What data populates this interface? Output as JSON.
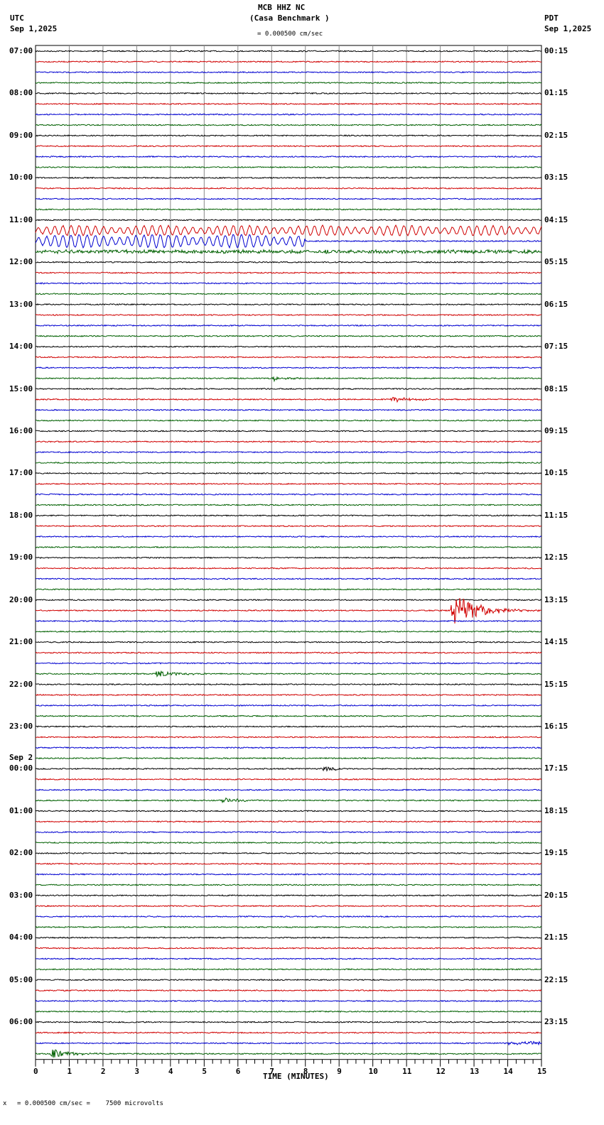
{
  "header": {
    "station": "MCB HHZ NC",
    "site": "(Casa Benchmark )",
    "left_tz": "UTC",
    "left_date": "Sep 1,2025",
    "right_tz": "PDT",
    "right_date": "Sep 1,2025",
    "scale": "= 0.000500 cm/sec"
  },
  "footer": {
    "scale": "= 0.000500 cm/sec =    7500 microvolts",
    "marker": "x"
  },
  "chart_data": {
    "type": "line",
    "title": "MCB HHZ NC (Casa Benchmark )",
    "xlabel": "TIME (MINUTES)",
    "xlim": [
      0,
      15
    ],
    "x_ticks": [
      "0",
      "1",
      "2",
      "3",
      "4",
      "5",
      "6",
      "7",
      "8",
      "9",
      "10",
      "11",
      "12",
      "13",
      "14",
      "15"
    ],
    "trace_count": 96,
    "trace_colors": [
      "#000000",
      "#d00000",
      "#0000d0",
      "#006000"
    ],
    "utc_labels": [
      "07:00",
      "08:00",
      "09:00",
      "10:00",
      "11:00",
      "12:00",
      "13:00",
      "14:00",
      "15:00",
      "16:00",
      "17:00",
      "18:00",
      "19:00",
      "20:00",
      "21:00",
      "22:00",
      "23:00",
      "00:00",
      "01:00",
      "02:00",
      "03:00",
      "04:00",
      "05:00",
      "06:00"
    ],
    "date_change_label": "Sep 2",
    "pdt_labels": [
      "00:15",
      "01:15",
      "02:15",
      "03:15",
      "04:15",
      "05:15",
      "06:15",
      "07:15",
      "08:15",
      "09:15",
      "10:15",
      "11:15",
      "12:15",
      "13:15",
      "14:15",
      "15:15",
      "16:15",
      "17:15",
      "18:15",
      "19:15",
      "20:15",
      "21:15",
      "22:15",
      "23:15"
    ],
    "events": [
      {
        "trace": 17,
        "start": 0,
        "end": 15,
        "amp": 7,
        "type": "wave"
      },
      {
        "trace": 18,
        "start": 0,
        "end": 8,
        "amp": 9,
        "type": "wave"
      },
      {
        "trace": 19,
        "start": 0,
        "end": 15,
        "amp": 2,
        "type": "noise"
      },
      {
        "trace": 31,
        "start": 7,
        "end": 9,
        "amp": 4,
        "type": "quake"
      },
      {
        "trace": 33,
        "start": 10.5,
        "end": 13,
        "amp": 4,
        "type": "quake"
      },
      {
        "trace": 53,
        "start": 12.3,
        "end": 15,
        "amp": 30,
        "type": "quake"
      },
      {
        "trace": 59,
        "start": 3.5,
        "end": 6,
        "amp": 5,
        "type": "quake"
      },
      {
        "trace": 60,
        "start": 5,
        "end": 6,
        "amp": 2,
        "type": "quake"
      },
      {
        "trace": 68,
        "start": 8.5,
        "end": 10,
        "amp": 4,
        "type": "quake"
      },
      {
        "trace": 71,
        "start": 5.5,
        "end": 7.5,
        "amp": 4,
        "type": "quake"
      },
      {
        "trace": 94,
        "start": 14,
        "end": 15,
        "amp": 2,
        "type": "noise"
      },
      {
        "trace": 95,
        "start": 0.4,
        "end": 2.5,
        "amp": 9,
        "type": "quake"
      }
    ]
  }
}
